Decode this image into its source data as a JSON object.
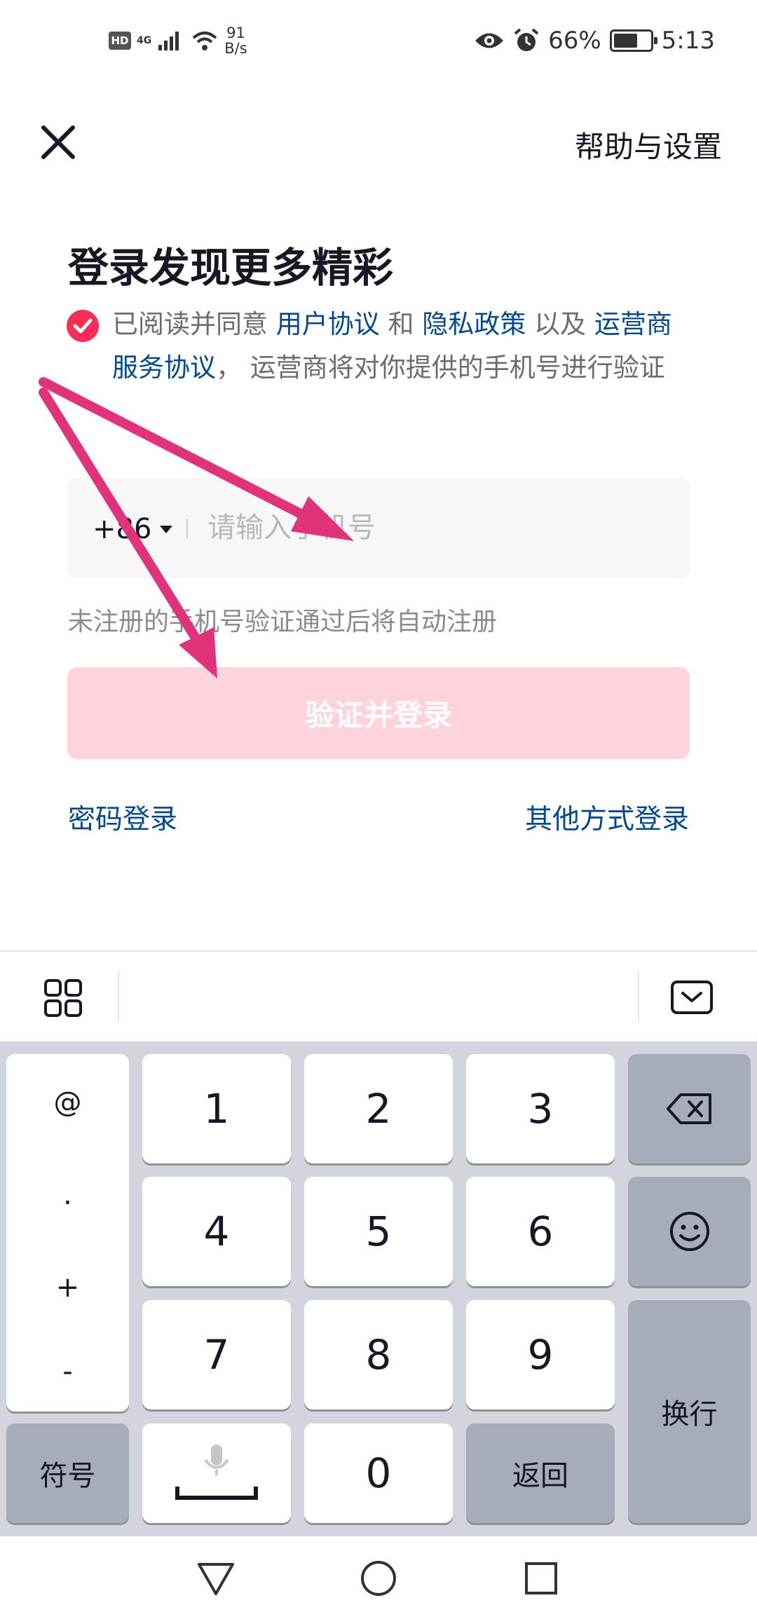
{
  "status_bar": {
    "hd": "HD",
    "net_type": "4G",
    "net_speed_value": "91",
    "net_speed_unit": "B/s",
    "battery": "66%",
    "battery_level": 0.66,
    "time": "5:13"
  },
  "header": {
    "help_label": "帮助与设置"
  },
  "title": "登录发现更多精彩",
  "agreement": {
    "t1": "已阅读并同意 ",
    "link1": "用户协议",
    "t2": " 和 ",
    "link2": "隐私政策",
    "t3": " 以及 ",
    "link3": "运营商服务协议",
    "t4": "， 运营商将对你提供的手机号进行验证"
  },
  "phone": {
    "country_code": "+86",
    "placeholder": "请输入手机号"
  },
  "hint": "未注册的手机号验证通过后将自动注册",
  "login_button": "验证并登录",
  "links": {
    "password_login": "密码登录",
    "other_login": "其他方式登录"
  },
  "keyboard": {
    "symbols": [
      "@",
      ".",
      "+",
      "-"
    ],
    "digits": [
      "1",
      "2",
      "3",
      "4",
      "5",
      "6",
      "7",
      "8",
      "9",
      "0"
    ],
    "symbol_key": "符号",
    "return_key": "返回",
    "newline_key": "换行"
  },
  "colors": {
    "accent": "#fe2c55",
    "link": "#04498d",
    "button_disabled": "#fed3dc",
    "annotation_arrow": "#e0337a"
  }
}
